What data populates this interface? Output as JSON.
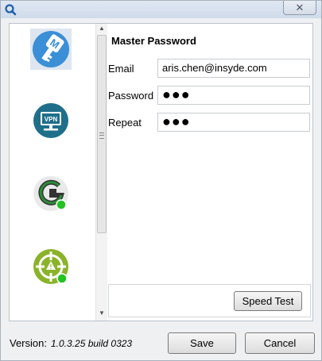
{
  "titlebar": {
    "close_glyph": "✕"
  },
  "services": [
    {
      "name": "master-password",
      "icon": "key-m-icon",
      "color": "#3a8fd6"
    },
    {
      "name": "vpn",
      "icon": "vpn-icon",
      "color": "#1f6f8b"
    },
    {
      "name": "g-service",
      "icon": "g-logo-icon",
      "color": "#2e8b3a",
      "status": "online"
    },
    {
      "name": "crosshair-service",
      "icon": "crosshair-icon",
      "color": "#8ab32a",
      "status": "online"
    }
  ],
  "form": {
    "title": "Master Password",
    "email_label": "Email",
    "email_value": "aris.chen@insyde.com",
    "password_label": "Password",
    "password_value": "●●●",
    "repeat_label": "Repeat",
    "repeat_value": "●●●"
  },
  "buttons": {
    "speed_test": "Speed Test",
    "save": "Save",
    "cancel": "Cancel"
  },
  "footer": {
    "version_label": "Version:",
    "version_value": "1.0.3.25 build 0323"
  },
  "colors": {
    "online_dot": "#22c322",
    "titlebar": "#d6e1ee"
  }
}
